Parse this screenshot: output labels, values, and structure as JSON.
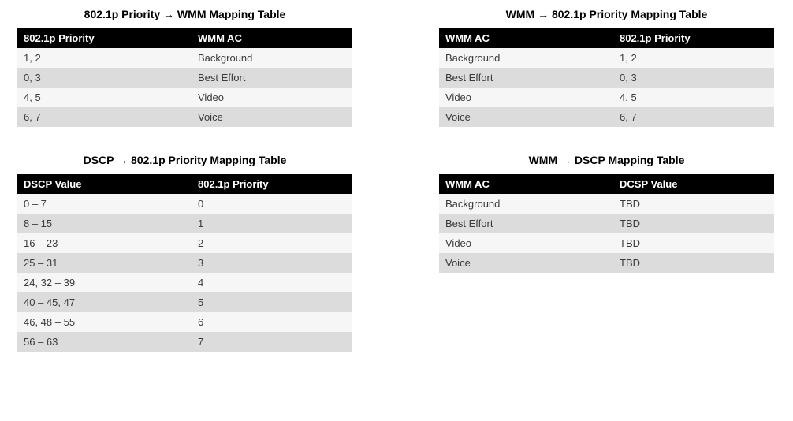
{
  "arrow": "→",
  "tables": [
    {
      "id": "table-8021p-to-wmm",
      "title_parts": [
        "802.1p Priority ",
        " WMM Mapping Table"
      ],
      "headers": [
        "802.1p Priority",
        "WMM AC"
      ],
      "rows": [
        [
          "1, 2",
          "Background"
        ],
        [
          "0, 3",
          "Best Effort"
        ],
        [
          "4, 5",
          "Video"
        ],
        [
          "6, 7",
          "Voice"
        ]
      ]
    },
    {
      "id": "table-wmm-to-8021p",
      "title_parts": [
        "WMM ",
        " 802.1p Priority Mapping Table"
      ],
      "headers": [
        "WMM AC",
        "802.1p Priority"
      ],
      "rows": [
        [
          "Background",
          "1, 2"
        ],
        [
          "Best Effort",
          "0, 3"
        ],
        [
          "Video",
          "4, 5"
        ],
        [
          "Voice",
          "6, 7"
        ]
      ]
    },
    {
      "id": "table-dscp-to-8021p",
      "title_parts": [
        "DSCP ",
        " 802.1p Priority Mapping Table"
      ],
      "headers": [
        "DSCP Value",
        "802.1p Priority"
      ],
      "rows": [
        [
          "0 – 7",
          "0"
        ],
        [
          "8 – 15",
          "1"
        ],
        [
          "16 – 23",
          "2"
        ],
        [
          "25 – 31",
          "3"
        ],
        [
          "24, 32 – 39",
          "4"
        ],
        [
          "40 – 45, 47",
          "5"
        ],
        [
          "46, 48 – 55",
          "6"
        ],
        [
          "56 – 63",
          "7"
        ]
      ]
    },
    {
      "id": "table-wmm-to-dscp",
      "title_parts": [
        "WMM ",
        " DSCP Mapping Table"
      ],
      "headers": [
        "WMM AC",
        "DCSP Value"
      ],
      "rows": [
        [
          "Background",
          "TBD"
        ],
        [
          "Best Effort",
          "TBD"
        ],
        [
          "Video",
          "TBD"
        ],
        [
          "Voice",
          "TBD"
        ]
      ]
    }
  ]
}
